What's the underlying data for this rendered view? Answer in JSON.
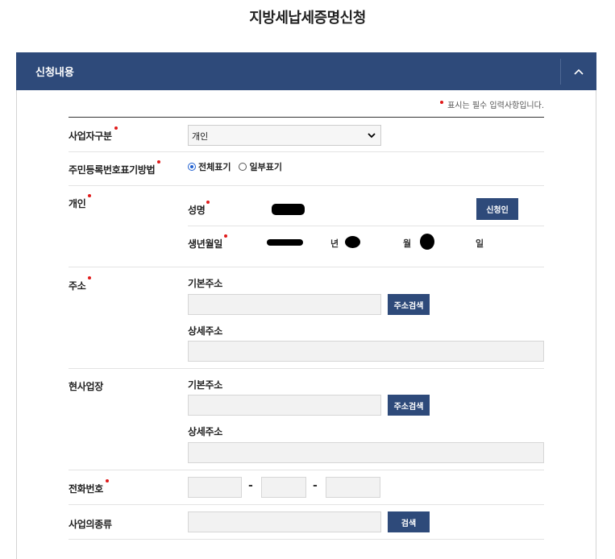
{
  "page": {
    "title": "지방세납세증명신청"
  },
  "panel": {
    "title": "신청내용"
  },
  "required_note": "표시는 필수 입력사항입니다.",
  "form": {
    "business_type": {
      "label": "사업자구분",
      "value": "개인"
    },
    "rrn_display": {
      "label": "주민등록번호표기방법",
      "options": [
        "전체표기",
        "일부표기"
      ],
      "selected": "전체표기"
    },
    "individual": {
      "label": "개인",
      "name_label": "성명",
      "applicant_button": "신청인",
      "birth_label": "생년월일",
      "year_unit": "년",
      "month_unit": "월",
      "day_unit": "일"
    },
    "address": {
      "label": "주소",
      "basic_label": "기본주소",
      "search_button": "주소검색",
      "detail_label": "상세주소"
    },
    "business_site": {
      "label": "현사업장",
      "basic_label": "기본주소",
      "search_button": "주소검색",
      "detail_label": "상세주소"
    },
    "phone": {
      "label": "전화번호",
      "separator": "-"
    },
    "business_kind": {
      "label": "사업의종류",
      "search_button": "검색"
    }
  },
  "colors": {
    "header": "#2e4a7a",
    "button": "#2e4a7a",
    "required_dot": "#e01b1b"
  }
}
